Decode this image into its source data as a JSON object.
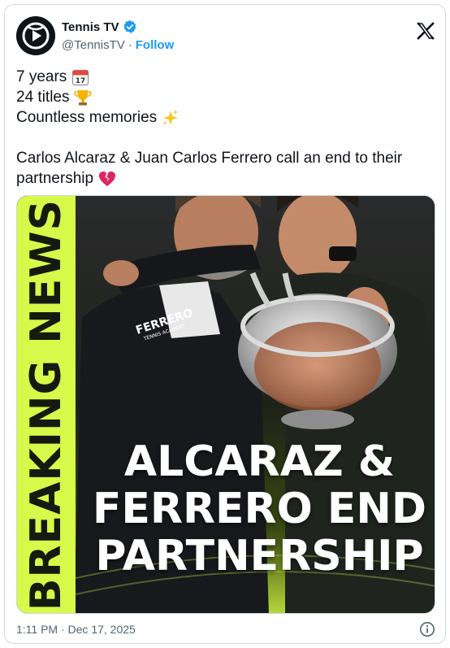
{
  "author": {
    "display_name": "Tennis TV",
    "handle": "@TennisTV",
    "separator": "·",
    "follow_label": "Follow"
  },
  "tweet": {
    "lines": [
      "7 years",
      "24 titles",
      "Countless memories"
    ],
    "paragraph": [
      "Carlos Alcaraz & Juan Carlos Ferrero call an end to their",
      "partnership"
    ]
  },
  "media": {
    "side_banner": "BREAKING NEWS",
    "headline": [
      "ALCARAZ &",
      "FERRERO END",
      "PARTNERSHIP"
    ],
    "logo_text": [
      "FERRERO",
      "TENNIS ACADEMY"
    ],
    "accent_color": "#d6f94a"
  },
  "footer": {
    "timestamp": "1:11 PM · Dec 17, 2025"
  },
  "icons": {
    "verified": "verified-badge-icon",
    "x_logo": "x-logo-icon",
    "calendar": "calendar-emoji",
    "trophy": "trophy-emoji",
    "sparkles": "sparkles-emoji",
    "broken_heart": "broken-heart-emoji",
    "info": "info-icon"
  },
  "colors": {
    "link": "#1d9bf0",
    "muted": "#536471",
    "text": "#0f1419"
  }
}
